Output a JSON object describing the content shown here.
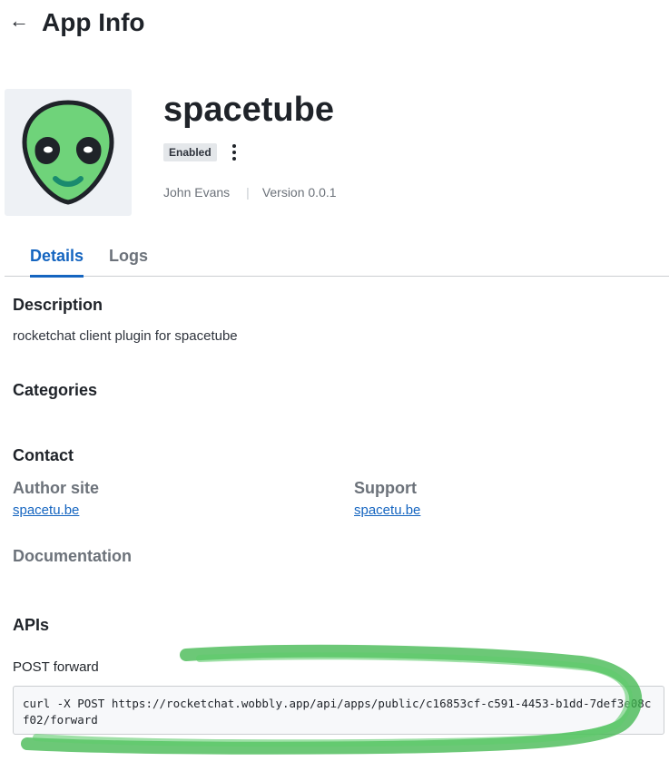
{
  "header": {
    "title": "App Info",
    "back_icon": "arrow-left-icon"
  },
  "app": {
    "name": "spacetube",
    "status": "Enabled",
    "author": "John Evans",
    "version": "Version 0.0.1",
    "icon": "alien-face-icon"
  },
  "tabs": [
    {
      "label": "Details",
      "active": true
    },
    {
      "label": "Logs",
      "active": false
    }
  ],
  "details": {
    "description_title": "Description",
    "description_text": "rocketchat client plugin for spacetube",
    "categories_title": "Categories",
    "contact_title": "Contact",
    "author_site_title": "Author site",
    "author_site_link": "spacetu.be",
    "support_title": "Support",
    "support_link": "spacetu.be",
    "documentation_title": "Documentation",
    "apis_title": "APIs",
    "api_label": "POST forward",
    "api_code": "curl -X POST https://rocketchat.wobbly.app/api/apps/public/c16853cf-c591-4453-b1dd-7def3e08cf02/forward"
  },
  "colors": {
    "accent": "#1565c0",
    "highlight": "#3bb54a",
    "alien_green": "#6fd37a"
  }
}
